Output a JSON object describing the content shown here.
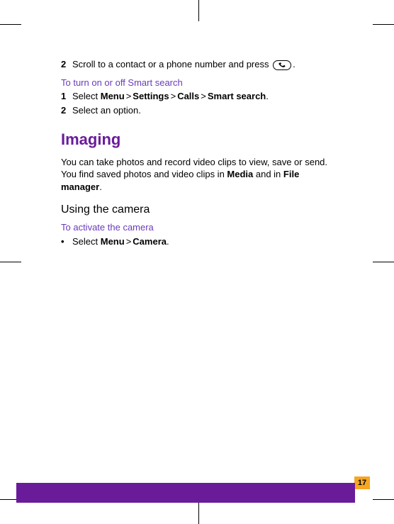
{
  "step2_prefix": "Scroll to a contact or a phone number and press ",
  "step2_suffix": ".",
  "smart_search": {
    "heading": "To turn on or off Smart search",
    "step1_prefix": "Select ",
    "step1_menu": "Menu",
    "step1_settings": "Settings",
    "step1_calls": "Calls",
    "step1_smart": "Smart search",
    "step1_suffix": ".",
    "step2": "Select an option."
  },
  "imaging": {
    "title": "Imaging",
    "para_prefix": "You can take photos and record video clips to view, save or send. You find saved photos and video clips in ",
    "para_media": "Media",
    "para_mid": " and in ",
    "para_filemgr": "File manager",
    "para_suffix": "."
  },
  "camera": {
    "heading": "Using the camera",
    "sub": "To activate the camera",
    "step_prefix": "Select ",
    "step_menu": "Menu",
    "step_camera": "Camera",
    "step_suffix": "."
  },
  "page_number": "17",
  "labels": {
    "num1": "1",
    "num2": "2",
    "bullet": "•",
    "gt": ">"
  }
}
